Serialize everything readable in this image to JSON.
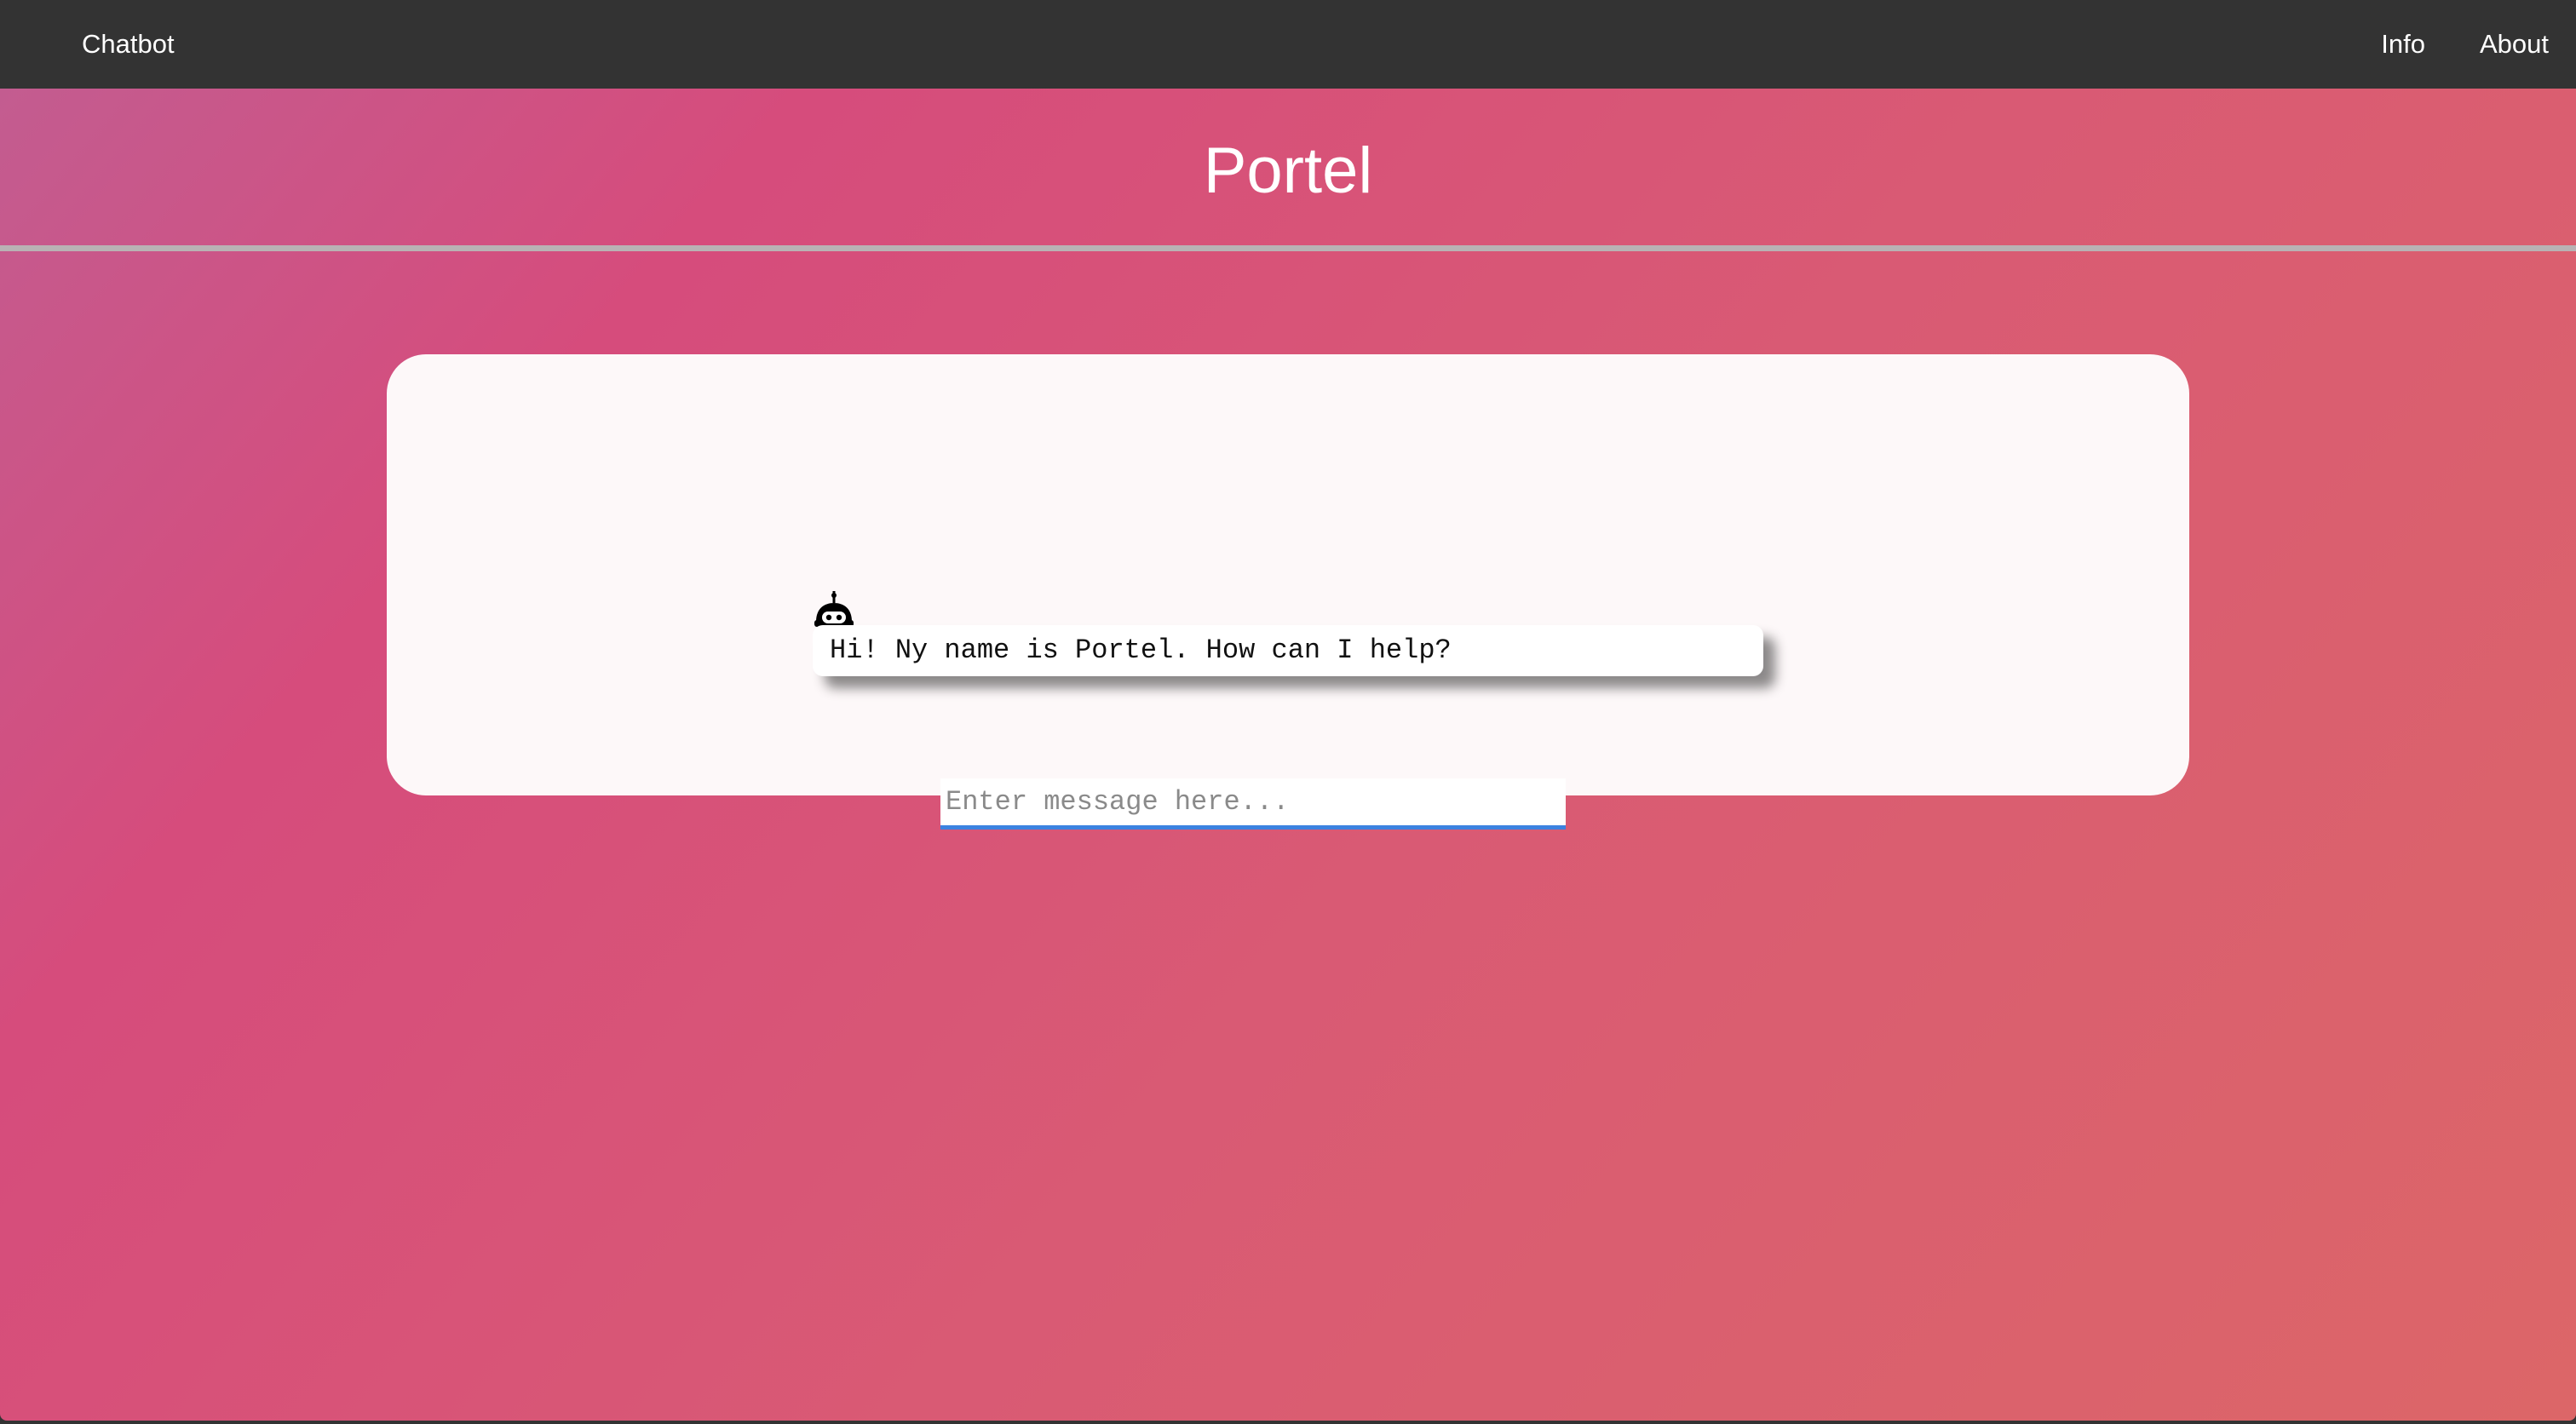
{
  "navbar": {
    "brand": "Chatbot",
    "links": [
      {
        "label": "Info"
      },
      {
        "label": "About"
      }
    ]
  },
  "header": {
    "title": "Portel"
  },
  "chat": {
    "messages": [
      {
        "sender": "bot",
        "icon": "robot-icon",
        "text": "Hi! Ny name is Portel. How can I help?"
      }
    ],
    "input": {
      "value": "",
      "placeholder": "Enter message here..."
    }
  },
  "colors": {
    "navbar_bg": "#333333",
    "gradient_start": "#c35c90",
    "gradient_mid": "#d64c7c",
    "gradient_end": "#dc6668",
    "card_bg": "#fdf8f9",
    "input_focus": "#3c82e0"
  }
}
